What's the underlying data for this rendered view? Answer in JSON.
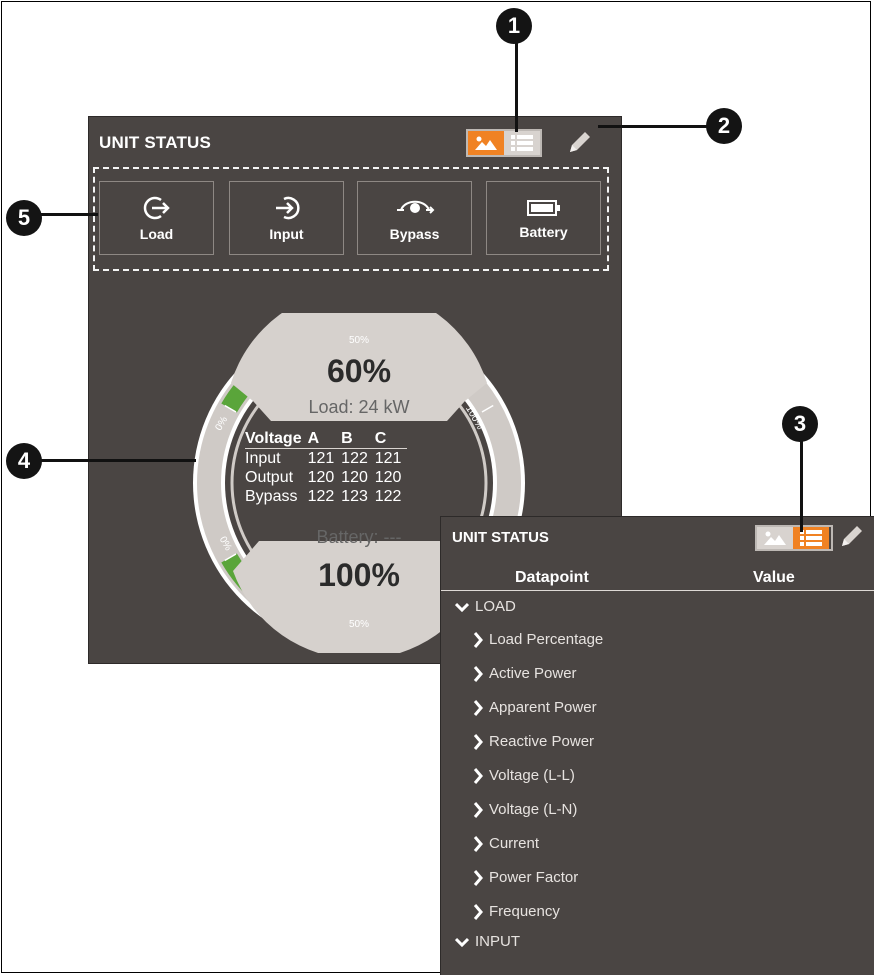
{
  "callouts": {
    "c1": "1",
    "c2": "2",
    "c3": "3",
    "c4": "4",
    "c5": "5"
  },
  "panel1": {
    "title": "UNIT STATUS",
    "tiles": [
      {
        "label": "Load",
        "icon": "load-icon"
      },
      {
        "label": "Input",
        "icon": "input-icon"
      },
      {
        "label": "Bypass",
        "icon": "bypass-icon"
      },
      {
        "label": "Battery",
        "icon": "battery-icon"
      }
    ],
    "gauge": {
      "load_percent": "60%",
      "load_text": "Load: 24 kW",
      "battery_text": "Battery: ---",
      "battery_percent": "100%",
      "load_value": 0.6,
      "battery_value": 1.0,
      "scale_top": {
        "start": "0%",
        "mid": "50%",
        "end": "100%"
      },
      "scale_bottom": {
        "start": "0%",
        "mid": "50%"
      },
      "voltage_table": {
        "headers": [
          "Voltage",
          "A",
          "B",
          "C"
        ],
        "rows": [
          [
            "Input",
            "121",
            "122",
            "121"
          ],
          [
            "Output",
            "120",
            "120",
            "120"
          ],
          [
            "Bypass",
            "122",
            "123",
            "122"
          ]
        ]
      }
    }
  },
  "panel2": {
    "title": "UNIT STATUS",
    "col_datapoint": "Datapoint",
    "col_value": "Value",
    "groups": [
      {
        "label": "LOAD"
      },
      {
        "label": "INPUT"
      }
    ],
    "items": [
      "Load Percentage",
      "Active Power",
      "Apparent Power",
      "Reactive Power",
      "Voltage (L-L)",
      "Voltage (L-N)",
      "Current",
      "Power Factor",
      "Frequency"
    ]
  },
  "colors": {
    "accent": "#f08223",
    "panel": "#4a4543",
    "gauge_green": "#5aa53a",
    "gauge_ring": "#cfcac6"
  }
}
